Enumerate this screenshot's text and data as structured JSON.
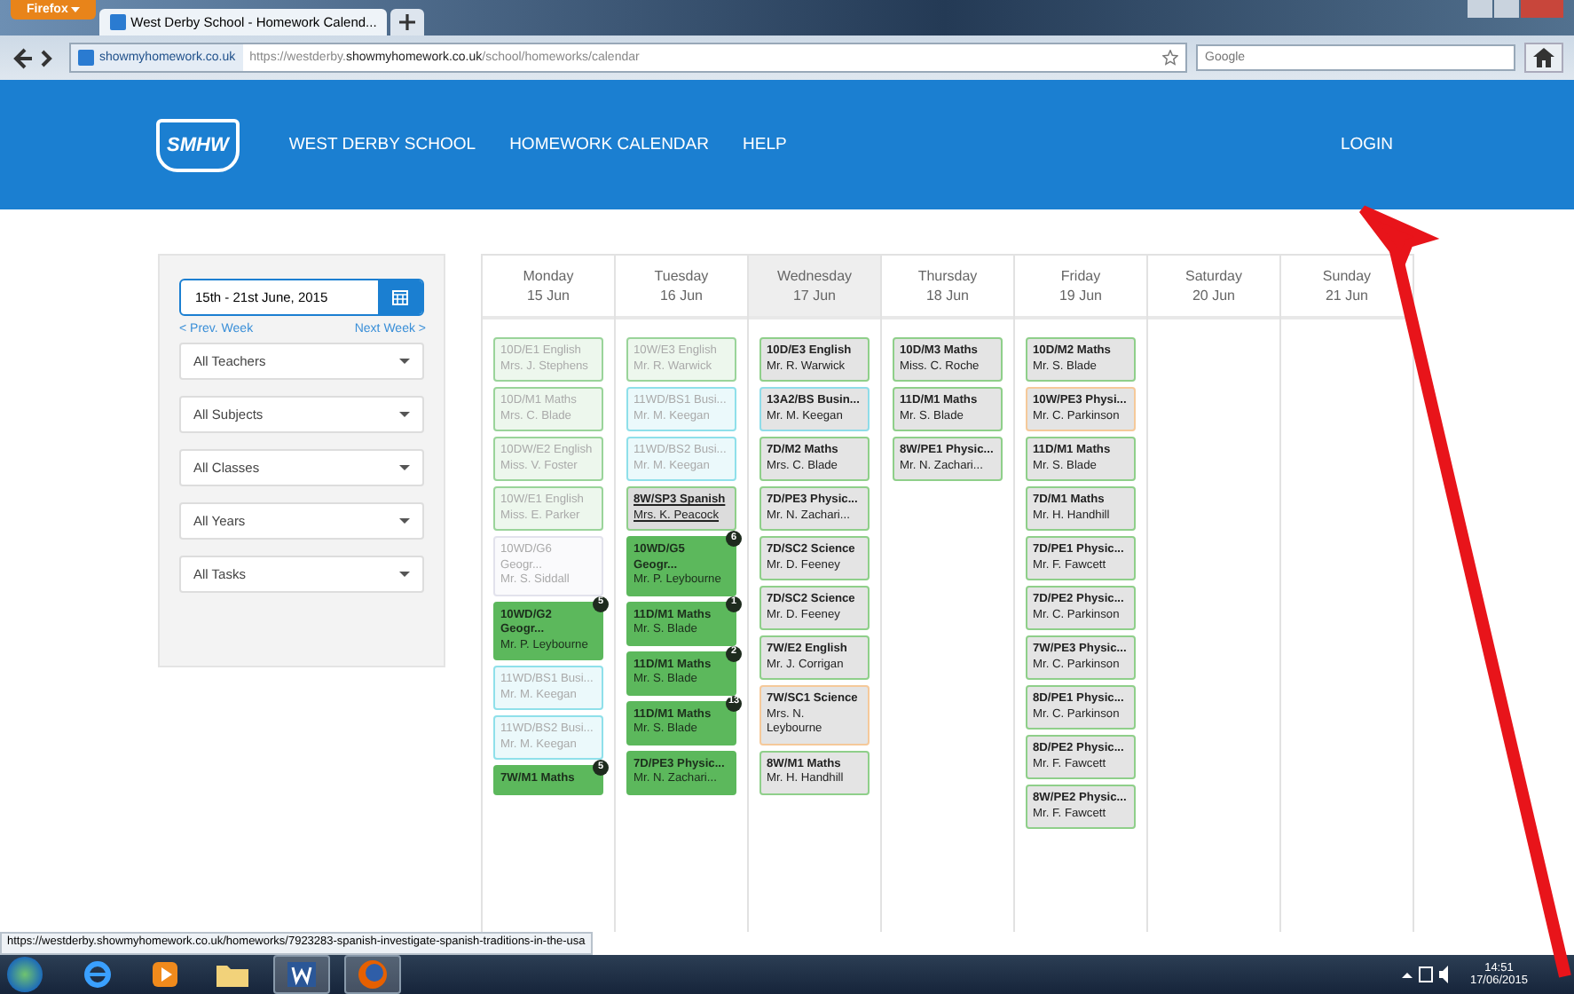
{
  "browser": {
    "menu_button": "Firefox",
    "tab_title": "West Derby School - Homework Calend...",
    "identity": "showmyhomework.co.uk",
    "url": {
      "prefix": "https://westderby.",
      "domain": "showmyhomework.co.uk",
      "path": "/school/homeworks/calendar"
    },
    "search": {
      "placeholder": "Google"
    }
  },
  "header": {
    "logo": "SMHW",
    "nav": [
      "WEST DERBY SCHOOL",
      "HOMEWORK CALENDAR",
      "HELP"
    ],
    "login": "LOGIN"
  },
  "sidebar": {
    "date_range": "15th - 21st June, 2015",
    "prev": "< Prev. Week",
    "next": "Next Week >",
    "filters": [
      "All Teachers",
      "All Subjects",
      "All Classes",
      "All Years",
      "All Tasks"
    ]
  },
  "calendar": {
    "days": [
      {
        "name": "Monday",
        "date": "15 Jun",
        "today": false,
        "tasks": [
          {
            "title": "10D/E1 English",
            "teacher": "Mrs. J. Stephens",
            "kind": "past",
            "color": "#9ad49a"
          },
          {
            "title": "10D/M1 Maths",
            "teacher": "Mrs. C. Blade",
            "kind": "past",
            "color": "#9ad49a"
          },
          {
            "title": "10DW/E2 English",
            "teacher": "Miss. V. Foster",
            "kind": "past",
            "color": "#9ad49a"
          },
          {
            "title": "10W/E1 English",
            "teacher": "Miss. E. Parker",
            "kind": "past",
            "color": "#9ad49a"
          },
          {
            "title": "10WD/G6 Geogr...",
            "teacher": "Mr. S. Siddall",
            "kind": "past",
            "color": "#e2e2ec"
          },
          {
            "title": "10WD/G2 Geogr...",
            "teacher": "Mr. P. Leybourne",
            "kind": "complete",
            "color": "#5cb85c",
            "badge": "5"
          },
          {
            "title": "11WD/BS1 Busi...",
            "teacher": "Mr. M. Keegan",
            "kind": "past",
            "color": "#8fe0ea"
          },
          {
            "title": "11WD/BS2 Busi...",
            "teacher": "Mr. M. Keegan",
            "kind": "past",
            "color": "#8fe0ea"
          },
          {
            "title": "7W/M1 Maths",
            "kind": "complete",
            "color": "#5cb85c",
            "badge": "5"
          }
        ]
      },
      {
        "name": "Tuesday",
        "date": "16 Jun",
        "today": false,
        "tasks": [
          {
            "title": "10W/E3 English",
            "teacher": "Mr. R. Warwick",
            "kind": "past",
            "color": "#9ad49a"
          },
          {
            "title": "11WD/BS1 Busi...",
            "teacher": "Mr. M. Keegan",
            "kind": "past",
            "color": "#8fe0ea"
          },
          {
            "title": "11WD/BS2 Busi...",
            "teacher": "Mr. M. Keegan",
            "kind": "past",
            "color": "#8fe0ea"
          },
          {
            "title": "8W/SP3 Spanish",
            "teacher": "Mrs. K. Peacock",
            "kind": "hovered",
            "color": "#8fcf8a"
          },
          {
            "title": "10WD/G5 Geogr...",
            "teacher": "Mr. P. Leybourne",
            "kind": "complete",
            "color": "#5cb85c",
            "badge": "6"
          },
          {
            "title": "11D/M1 Maths",
            "teacher": "Mr. S. Blade",
            "kind": "complete",
            "color": "#5cb85c",
            "badge": "1"
          },
          {
            "title": "11D/M1 Maths",
            "teacher": "Mr. S. Blade",
            "kind": "complete",
            "color": "#5cb85c",
            "badge": "2"
          },
          {
            "title": "11D/M1 Maths",
            "teacher": "Mr. S. Blade",
            "kind": "complete",
            "color": "#5cb85c",
            "badge": "13"
          },
          {
            "title": "7D/PE3 Physic...",
            "teacher": "Mr. N. Zachari...",
            "kind": "complete",
            "color": "#5cb85c"
          }
        ]
      },
      {
        "name": "Wednesday",
        "date": "17 Jun",
        "today": true,
        "tasks": [
          {
            "title": "10D/E3 English",
            "teacher": "Mr. R. Warwick",
            "kind": "current",
            "color": "#8fcf8a"
          },
          {
            "title": "13A2/BS Busin...",
            "teacher": "Mr. M. Keegan",
            "kind": "current",
            "color": "#8fdce8"
          },
          {
            "title": "7D/M2 Maths",
            "teacher": "Mrs. C. Blade",
            "kind": "current",
            "color": "#8fcf8a"
          },
          {
            "title": "7D/PE3 Physic...",
            "teacher": "Mr. N. Zachari...",
            "kind": "current",
            "color": "#8fcf8a"
          },
          {
            "title": "7D/SC2 Science",
            "teacher": "Mr. D. Feeney",
            "kind": "current",
            "color": "#8fcf8a"
          },
          {
            "title": "7D/SC2 Science",
            "teacher": "Mr. D. Feeney",
            "kind": "current",
            "color": "#8fcf8a"
          },
          {
            "title": "7W/E2 English",
            "teacher": "Mr. J. Corrigan",
            "kind": "current",
            "color": "#8fcf8a"
          },
          {
            "title": "7W/SC1 Science",
            "teacher": "Mrs. N. Leybourne",
            "kind": "current",
            "color": "#f5c99a"
          },
          {
            "title": "8W/M1 Maths",
            "teacher": "Mr. H. Handhill",
            "kind": "current",
            "color": "#8fcf8a"
          }
        ]
      },
      {
        "name": "Thursday",
        "date": "18 Jun",
        "today": false,
        "tasks": [
          {
            "title": "10D/M3 Maths",
            "teacher": "Miss. C. Roche",
            "kind": "current",
            "color": "#8fcf8a"
          },
          {
            "title": "11D/M1 Maths",
            "teacher": "Mr. S. Blade",
            "kind": "current",
            "color": "#8fcf8a"
          },
          {
            "title": "8W/PE1 Physic...",
            "teacher": "Mr. N. Zachari...",
            "kind": "current",
            "color": "#8fcf8a"
          }
        ]
      },
      {
        "name": "Friday",
        "date": "19 Jun",
        "today": false,
        "tasks": [
          {
            "title": "10D/M2 Maths",
            "teacher": "Mr. S. Blade",
            "kind": "current",
            "color": "#8fcf8a"
          },
          {
            "title": "10W/PE3 Physi...",
            "teacher": "Mr. C. Parkinson",
            "kind": "current",
            "color": "#f5c99a"
          },
          {
            "title": "11D/M1 Maths",
            "teacher": "Mr. S. Blade",
            "kind": "current",
            "color": "#8fcf8a"
          },
          {
            "title": "7D/M1 Maths",
            "teacher": "Mr. H. Handhill",
            "kind": "current",
            "color": "#8fcf8a"
          },
          {
            "title": "7D/PE1 Physic...",
            "teacher": "Mr. F. Fawcett",
            "kind": "current",
            "color": "#8fcf8a"
          },
          {
            "title": "7D/PE2 Physic...",
            "teacher": "Mr. C. Parkinson",
            "kind": "current",
            "color": "#8fcf8a"
          },
          {
            "title": "7W/PE3 Physic...",
            "teacher": "Mr. C. Parkinson",
            "kind": "current",
            "color": "#8fcf8a"
          },
          {
            "title": "8D/PE1 Physic...",
            "teacher": "Mr. C. Parkinson",
            "kind": "current",
            "color": "#8fcf8a"
          },
          {
            "title": "8D/PE2 Physic...",
            "teacher": "Mr. F. Fawcett",
            "kind": "current",
            "color": "#8fcf8a"
          },
          {
            "title": "8W/PE2 Physic...",
            "teacher": "Mr. F. Fawcett",
            "kind": "current",
            "color": "#8fcf8a"
          }
        ]
      },
      {
        "name": "Saturday",
        "date": "20 Jun",
        "today": false
      },
      {
        "name": "Sunday",
        "date": "21 Jun",
        "today": false
      }
    ]
  },
  "status_link": "https://westderby.showmyhomework.co.uk/homeworks/7923283-spanish-investigate-spanish-traditions-in-the-usa",
  "taskbar": {
    "time": "14:51",
    "date": "17/06/2015"
  }
}
